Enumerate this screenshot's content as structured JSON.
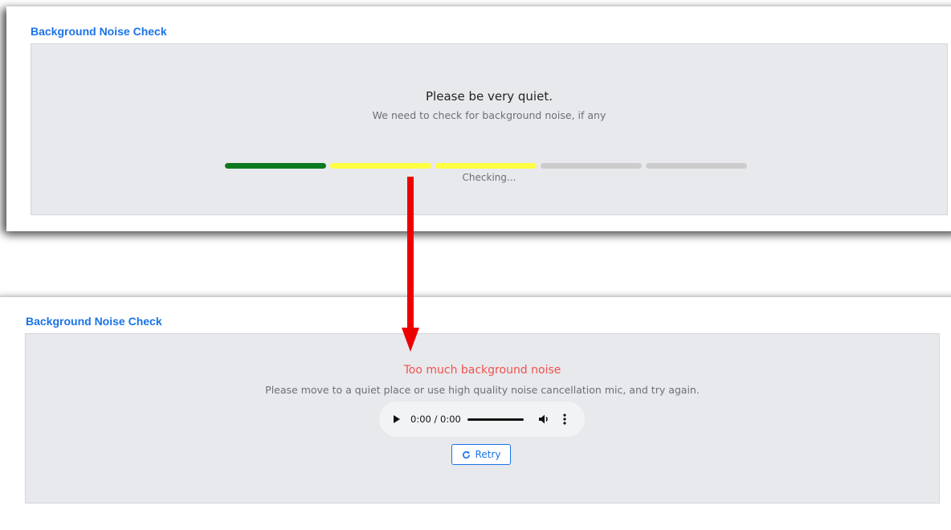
{
  "colors": {
    "accent": "#1a73e8",
    "error": "#f0524f",
    "arrow": "#ee0000",
    "panel_bg": "#e8e9ec"
  },
  "check_state": {
    "title": "Background Noise Check",
    "heading": "Please be very quiet.",
    "subtext": "We need to check for background noise, if any",
    "status": "Checking...",
    "meter_segments": [
      {
        "color": "#0b7a1f"
      },
      {
        "color": "#ffff44"
      },
      {
        "color": "#ffff44"
      },
      {
        "color": "#cccccc"
      },
      {
        "color": "#cccccc"
      }
    ]
  },
  "result_state": {
    "title": "Background Noise Check",
    "error_title": "Too much background noise",
    "message": "Please move to a quiet place or use high quality noise cancellation mic, and try again.",
    "audio_player": {
      "time": "0:00 / 0:00",
      "play_icon": "play-icon",
      "volume_icon": "volume-icon",
      "more_icon": "more-vert-icon"
    },
    "retry_label": "Retry",
    "retry_icon": "refresh-icon"
  }
}
